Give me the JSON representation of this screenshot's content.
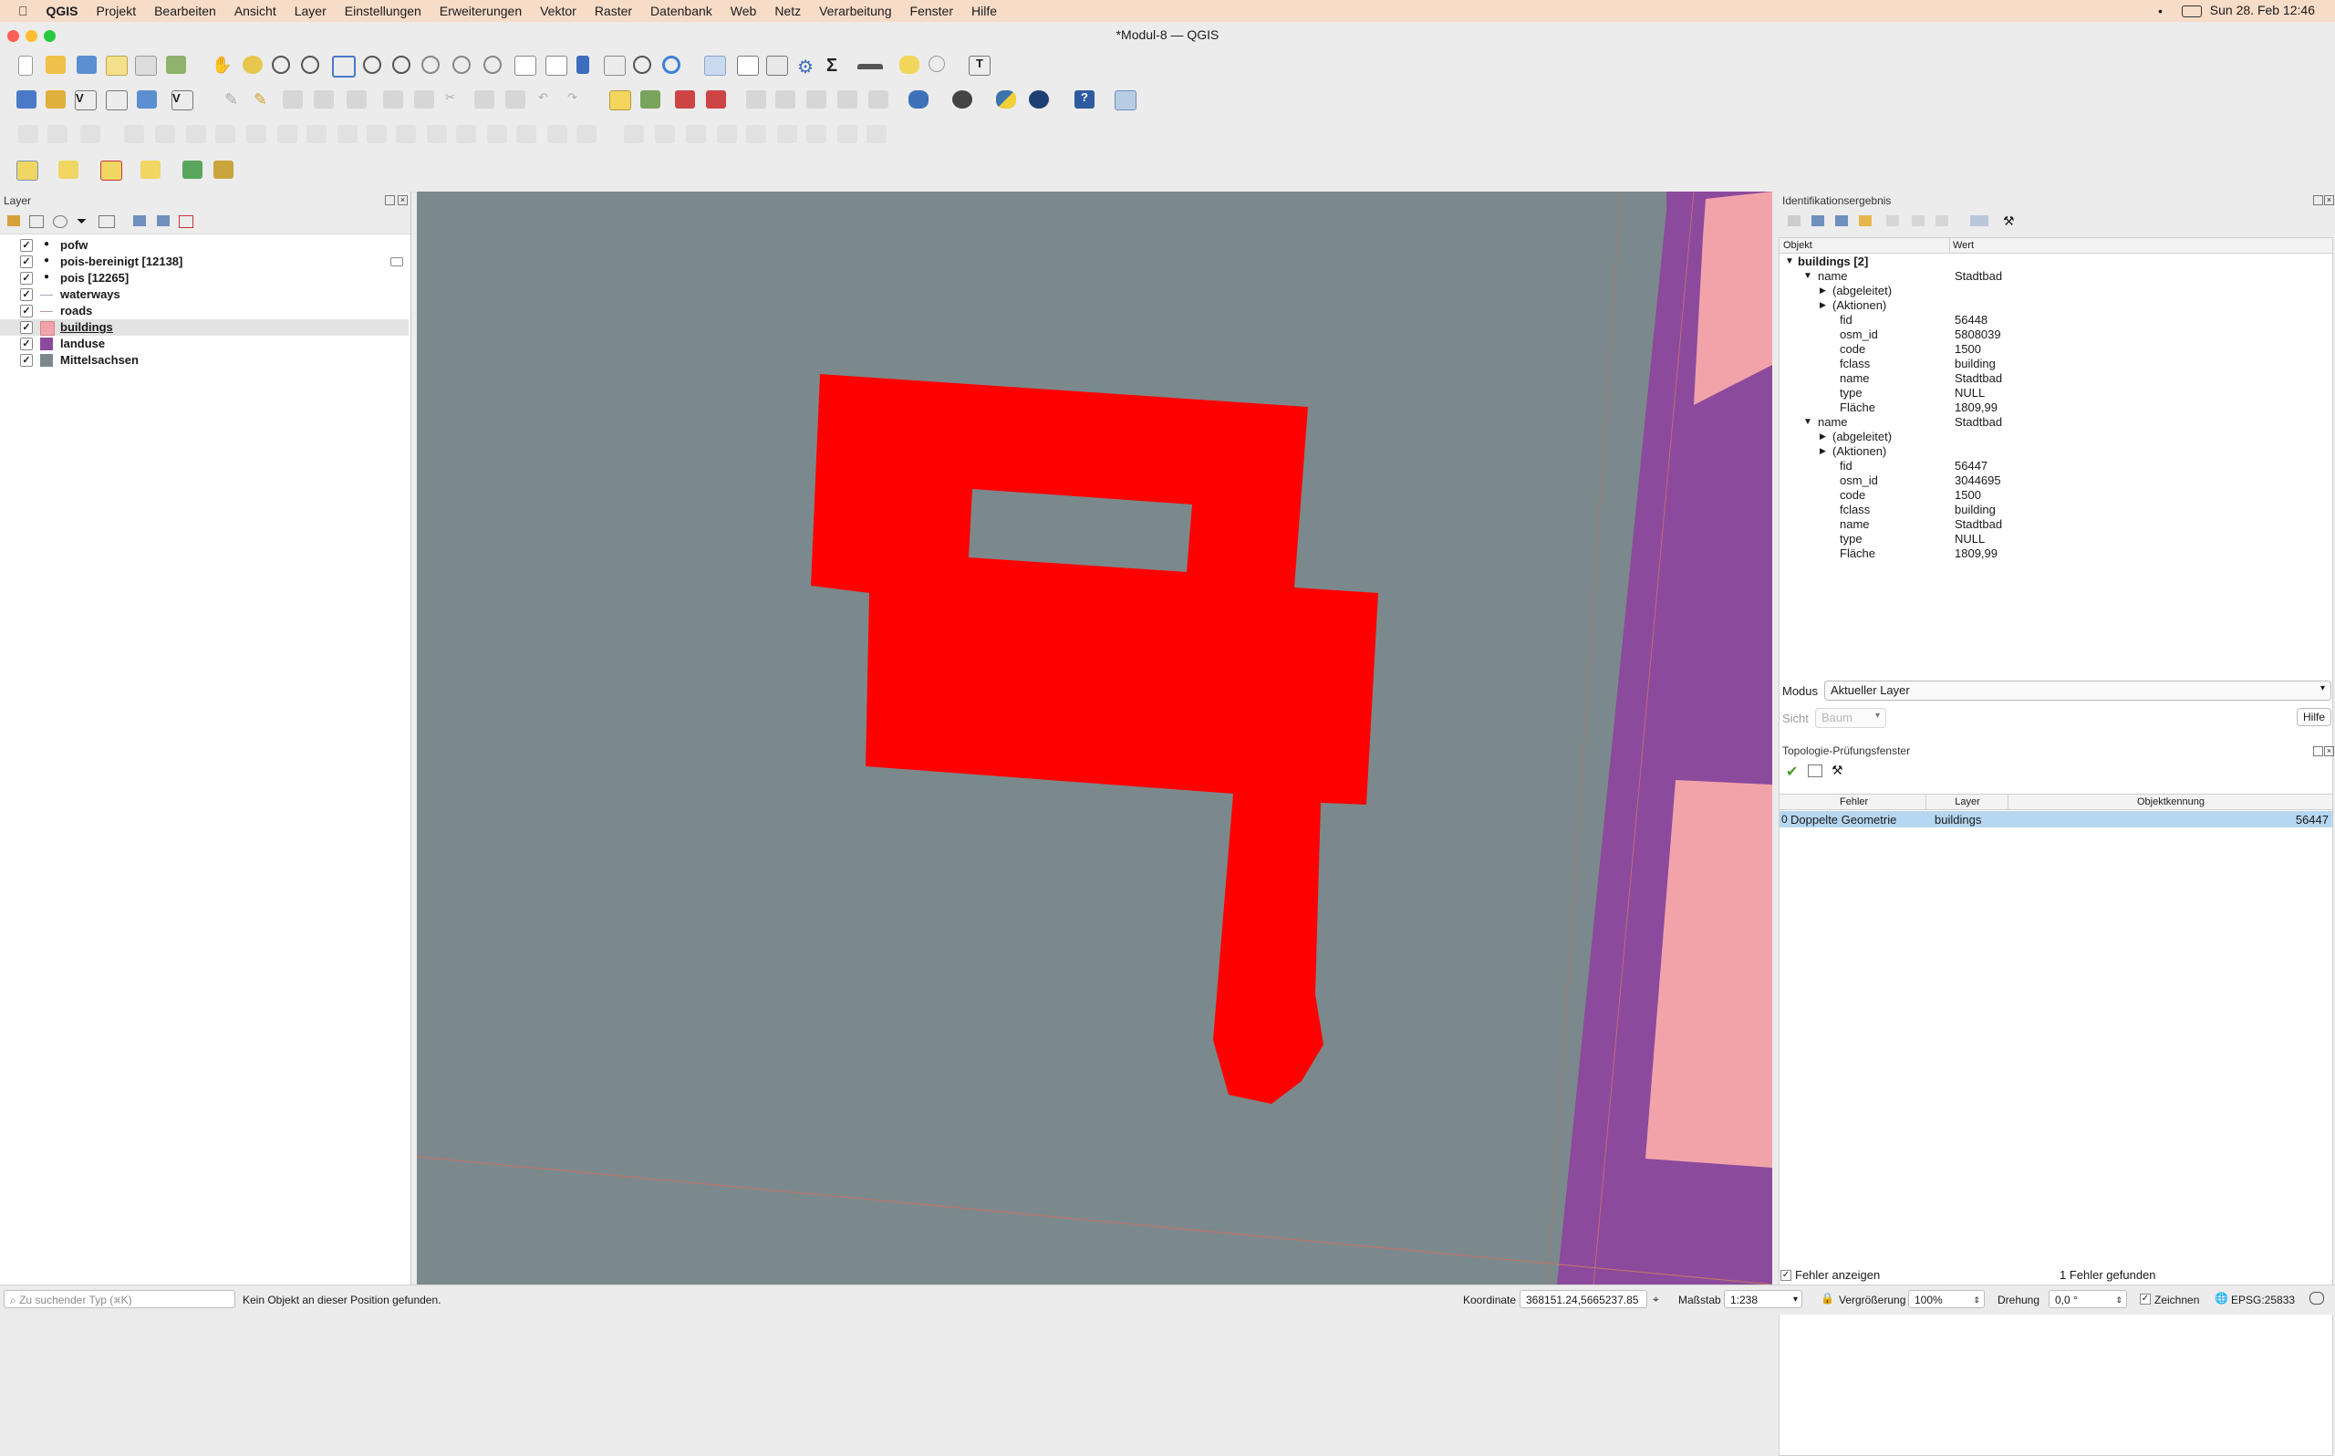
{
  "menubar": {
    "app": "QGIS",
    "items": [
      "Projekt",
      "Bearbeiten",
      "Ansicht",
      "Layer",
      "Einstellungen",
      "Erweiterungen",
      "Vektor",
      "Raster",
      "Datenbank",
      "Web",
      "Netz",
      "Verarbeitung",
      "Fenster",
      "Hilfe"
    ],
    "clock": "Sun 28. Feb  12:46"
  },
  "window": {
    "title": "*Modul-8 — QGIS"
  },
  "layers_panel": {
    "title": "Layer",
    "layers": [
      {
        "name": "pofw",
        "checked": true,
        "symbol": "point"
      },
      {
        "name": "pois-bereinigt [12138]",
        "checked": true,
        "symbol": "point"
      },
      {
        "name": "pois [12265]",
        "checked": true,
        "symbol": "point"
      },
      {
        "name": "waterways",
        "checked": true,
        "symbol": "line"
      },
      {
        "name": "roads",
        "checked": true,
        "symbol": "line"
      },
      {
        "name": "buildings",
        "checked": true,
        "symbol": "fill",
        "color": "#f2a3aa",
        "selected": true
      },
      {
        "name": "landuse",
        "checked": true,
        "symbol": "fill",
        "color": "#8b4a9c"
      },
      {
        "name": "Mittelsachsen",
        "checked": true,
        "symbol": "fill",
        "color": "#7b898c"
      }
    ]
  },
  "identify_panel": {
    "title": "Identifikationsergebnis",
    "col_object": "Objekt",
    "col_value": "Wert",
    "layer_label": "buildings [2]",
    "features": [
      {
        "key": "name",
        "value": "Stadtbad",
        "derived": "(abgeleitet)",
        "actions": "(Aktionen)",
        "attributes": [
          {
            "k": "fid",
            "v": "56448"
          },
          {
            "k": "osm_id",
            "v": "5808039"
          },
          {
            "k": "code",
            "v": "1500"
          },
          {
            "k": "fclass",
            "v": "building"
          },
          {
            "k": "name",
            "v": "Stadtbad"
          },
          {
            "k": "type",
            "v": "NULL"
          },
          {
            "k": "Fläche",
            "v": "1809,99"
          }
        ]
      },
      {
        "key": "name",
        "value": "Stadtbad",
        "derived": "(abgeleitet)",
        "actions": "(Aktionen)",
        "attributes": [
          {
            "k": "fid",
            "v": "56447"
          },
          {
            "k": "osm_id",
            "v": "3044695"
          },
          {
            "k": "code",
            "v": "1500"
          },
          {
            "k": "fclass",
            "v": "building"
          },
          {
            "k": "name",
            "v": "Stadtbad"
          },
          {
            "k": "type",
            "v": "NULL"
          },
          {
            "k": "Fläche",
            "v": "1809,99"
          }
        ]
      }
    ],
    "mode_label": "Modus",
    "mode_value": "Aktueller Layer",
    "view_label": "Sicht",
    "view_value": "Baum",
    "help": "Hilfe"
  },
  "topology_panel": {
    "title": "Topologie-Prüfungsfenster",
    "headers": [
      "Fehler",
      "Layer",
      "Objektkennung"
    ],
    "rows": [
      {
        "index": "0",
        "error": "Doppelte Geometrie",
        "layer": "buildings",
        "id": "56447"
      }
    ],
    "show_errors": "Fehler anzeigen",
    "found": "1 Fehler gefunden"
  },
  "statusbar": {
    "search_placeholder": "Zu suchender Typ (⌘K)",
    "message": "Kein Objekt an dieser Position gefunden.",
    "coord_label": "Koordinate",
    "coord_value": "368151.24,5665237.85",
    "scale_label": "Maßstab",
    "scale_value": "1:238",
    "magnifier_label": "Vergrößerung",
    "magnifier_value": "100%",
    "rotation_label": "Drehung",
    "rotation_value": "0,0 °",
    "render_label": "Zeichnen",
    "crs": "EPSG:25833"
  },
  "colors": {
    "canvas": "#7b898c",
    "selection": "#ff0000",
    "landuse": "#8b4a9c",
    "buildings": "#f2a3aa",
    "highlight_row": "#b6d7f1"
  }
}
